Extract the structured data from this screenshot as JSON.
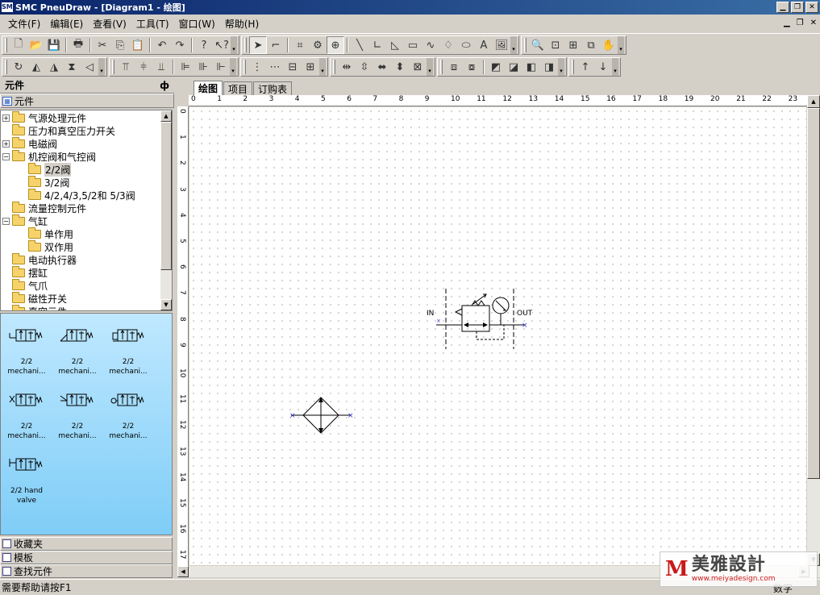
{
  "window": {
    "title": "SMC PneuDraw - [Diagram1 - 绘图]",
    "app_icon": "SMC"
  },
  "menu": {
    "items": [
      "文件(F)",
      "编辑(E)",
      "查看(V)",
      "工具(T)",
      "窗口(W)",
      "帮助(H)"
    ]
  },
  "panel": {
    "title": "元件",
    "pin": "ф",
    "section": "元件"
  },
  "tree": {
    "items": [
      {
        "label": "气源处理元件",
        "exp": "+"
      },
      {
        "label": "压力和真空压力开关",
        "exp": ""
      },
      {
        "label": "电磁阀",
        "exp": "+"
      },
      {
        "label": "机控阀和气控阀",
        "exp": "−"
      },
      {
        "label": "2/2阀",
        "exp": ""
      },
      {
        "label": "3/2阀",
        "exp": ""
      },
      {
        "label": "4/2,4/3,5/2和 5/3阀",
        "exp": ""
      },
      {
        "label": "流量控制元件",
        "exp": ""
      },
      {
        "label": "气缸",
        "exp": "−"
      },
      {
        "label": "单作用",
        "exp": ""
      },
      {
        "label": "双作用",
        "exp": ""
      },
      {
        "label": "电动执行器",
        "exp": ""
      },
      {
        "label": "摆缸",
        "exp": ""
      },
      {
        "label": "气爪",
        "exp": ""
      },
      {
        "label": "磁性开关",
        "exp": ""
      },
      {
        "label": "真空元件",
        "exp": ""
      }
    ]
  },
  "palette": {
    "items": [
      {
        "line1": "2/2",
        "line2": "mechani..."
      },
      {
        "line1": "2/2",
        "line2": "mechani..."
      },
      {
        "line1": "2/2",
        "line2": "mechani..."
      },
      {
        "line1": "2/2",
        "line2": "mechani..."
      },
      {
        "line1": "2/2",
        "line2": "mechani..."
      },
      {
        "line1": "2/2",
        "line2": "mechani..."
      },
      {
        "line1": "2/2 hand",
        "line2": "valve"
      }
    ]
  },
  "bottom_tabs": [
    "收藏夹",
    "模板",
    "查找元件"
  ],
  "doc_tabs": [
    "绘图",
    "项目",
    "订购表"
  ],
  "ruler": {
    "h": [
      "0",
      "1",
      "2",
      "3",
      "4",
      "5",
      "6",
      "7",
      "8",
      "9",
      "10",
      "11",
      "12",
      "13",
      "14",
      "15",
      "16",
      "17",
      "18",
      "19",
      "20",
      "21",
      "22",
      "23"
    ],
    "v": [
      "0",
      "1",
      "2",
      "3",
      "4",
      "5",
      "6",
      "7",
      "8",
      "9",
      "10",
      "11",
      "12",
      "13",
      "14",
      "15",
      "16",
      "17"
    ]
  },
  "diagram": {
    "in_label": "IN",
    "out_label": "OUT"
  },
  "status": {
    "help": "需要帮助请按F1",
    "mode": "数字"
  },
  "watermark": {
    "logo": "M",
    "cn": "美雅設計",
    "url": "www.meiyadesign.com"
  },
  "colors": {
    "titlebar_start": "#0a246a",
    "titlebar_end": "#3a6ea5",
    "palette_bg": "#7fcdf7",
    "folder": "#f6d36a"
  }
}
